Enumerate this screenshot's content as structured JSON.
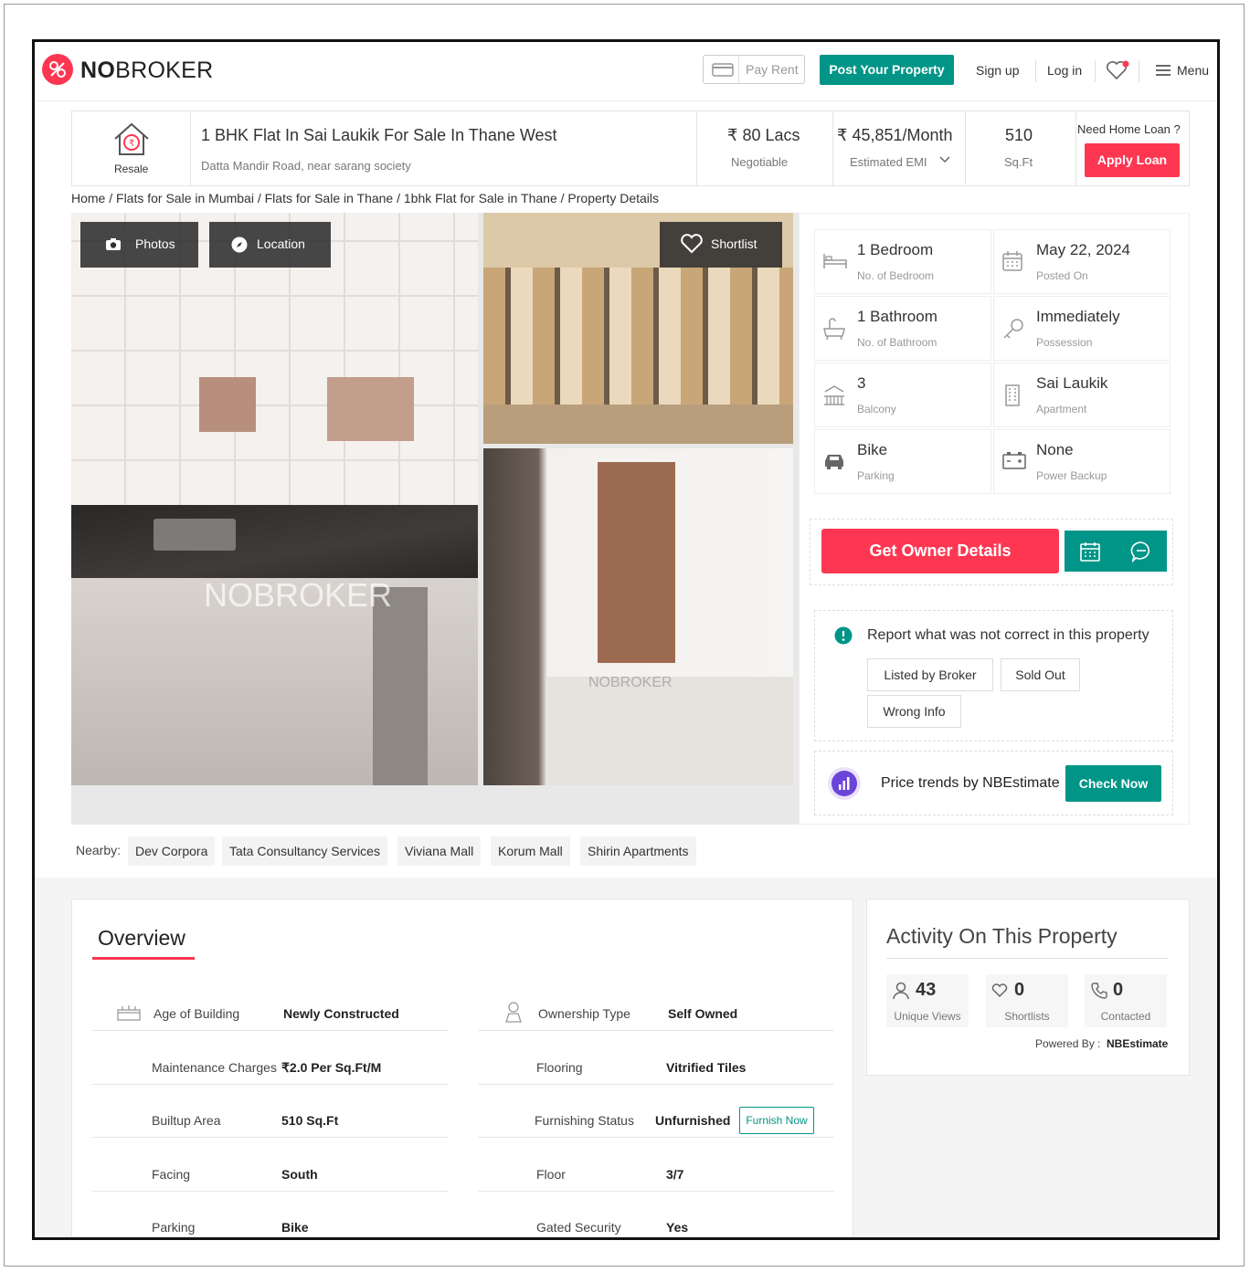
{
  "header": {
    "brand_prefix": "NO",
    "brand_suffix": "BROKER",
    "pay_rent": "Pay Rent",
    "post_property": "Post Your Property",
    "sign_up": "Sign up",
    "log_in": "Log in",
    "menu": "Menu"
  },
  "listing": {
    "resale_label": "Resale",
    "title": "1 BHK Flat In Sai Laukik For Sale In Thane West",
    "address": "Datta Mandir Road, near sarang society",
    "price": "₹ 80 Lacs",
    "price_note": "Negotiable",
    "emi": "₹ 45,851/Month",
    "emi_note": "Estimated EMI",
    "area": "510",
    "area_unit": "Sq.Ft",
    "loan_question": "Need Home Loan ?",
    "apply_loan": "Apply Loan"
  },
  "breadcrumb": "Home / Flats for Sale in Mumbai / Flats for Sale in Thane / 1bhk Flat for Sale in Thane / Property Details",
  "gallery": {
    "photos": "Photos",
    "location": "Location",
    "shortlist": "Shortlist",
    "watermark": "NOBROKER"
  },
  "details": [
    {
      "value": "1 Bedroom",
      "label": "No. of Bedroom",
      "icon": "bed-icon"
    },
    {
      "value": "May 22, 2024",
      "label": "Posted On",
      "icon": "calendar-icon"
    },
    {
      "value": "1 Bathroom",
      "label": "No. of Bathroom",
      "icon": "bathtub-icon"
    },
    {
      "value": "Immediately",
      "label": "Possession",
      "icon": "key-icon"
    },
    {
      "value": "3",
      "label": "Balcony",
      "icon": "balcony-icon"
    },
    {
      "value": "Sai Laukik",
      "label": "Apartment",
      "icon": "building-icon"
    },
    {
      "value": "Bike",
      "label": "Parking",
      "icon": "car-icon"
    },
    {
      "value": "None",
      "label": "Power Backup",
      "icon": "battery-icon"
    }
  ],
  "actions": {
    "get_owner": "Get Owner Details"
  },
  "report": {
    "title": "Report what was not correct in this property",
    "options": [
      "Listed by Broker",
      "Sold Out",
      "Wrong Info"
    ]
  },
  "trends": {
    "text": "Price trends by NBEstimate",
    "button": "Check Now"
  },
  "nearby": {
    "label": "Nearby:",
    "places": [
      "Dev Corpora",
      "Tata Consultancy Services",
      "Viviana Mall",
      "Korum Mall",
      "Shirin Apartments"
    ]
  },
  "overview": {
    "title": "Overview",
    "left": [
      {
        "label": "Age of Building",
        "value": "Newly Constructed"
      },
      {
        "label": "Maintenance Charges",
        "value": "₹2.0 Per Sq.Ft/M"
      },
      {
        "label": "Builtup Area",
        "value": "510 Sq.Ft"
      },
      {
        "label": "Facing",
        "value": "South"
      },
      {
        "label": "Parking",
        "value": "Bike"
      }
    ],
    "right": [
      {
        "label": "Ownership Type",
        "value": "Self Owned"
      },
      {
        "label": "Flooring",
        "value": "Vitrified Tiles"
      },
      {
        "label": "Furnishing Status",
        "value": "Unfurnished"
      },
      {
        "label": "Floor",
        "value": "3/7"
      },
      {
        "label": "Gated Security",
        "value": "Yes"
      }
    ],
    "furnish_now": "Furnish Now"
  },
  "activity": {
    "title": "Activity On This Property",
    "views": "43",
    "views_label": "Unique Views",
    "shortlists": "0",
    "shortlists_label": "Shortlists",
    "contacted": "0",
    "contacted_label": "Contacted",
    "powered_label": "Powered By :",
    "powered_by": "NBEstimate"
  },
  "colors": {
    "brand_red": "#fd3752",
    "brand_green": "#009587"
  }
}
